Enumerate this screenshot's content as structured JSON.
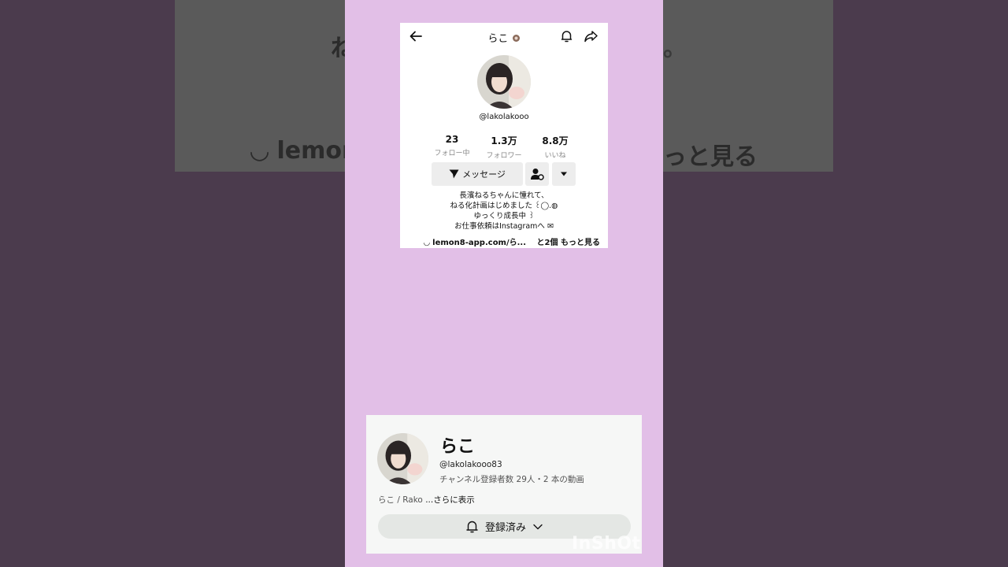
{
  "background": {
    "left_text": "ね",
    "link_text": "◡ lemon",
    "right_text": "っと見る",
    "tail_text": "。"
  },
  "tiktok": {
    "username_title": "らこ",
    "handle": "@lakolakooo",
    "stats": [
      {
        "value": "23",
        "label": "フォロー中"
      },
      {
        "value": "1.3万",
        "label": "フォロワー"
      },
      {
        "value": "8.8万",
        "label": "いいね"
      }
    ],
    "message_button": "メッセージ",
    "bio_lines": [
      "長濱ねるちゃんに憧れて、",
      "ねる化計画はじめました ꒰◯.◍",
      "ゆっくり成長中 ꒱",
      "お仕事依頼はInstagramへ ✉"
    ],
    "link": "◡ lemon8-app.com/ら...",
    "link_more": "と2個 もっと見る"
  },
  "youtube": {
    "channel_name": "らこ",
    "handle": "@lakolakooo83",
    "meta": "チャンネル登録者数 29人・2 本の動画",
    "description": "らこ / Rako",
    "description_more": "...さらに表示",
    "subscribe_label": "登録済み"
  },
  "watermark": "InShOt",
  "icons": [
    "back-arrow-icon",
    "bell-icon",
    "share-icon",
    "send-icon",
    "person-settings-icon",
    "caret-down-icon",
    "chevron-down-icon"
  ]
}
